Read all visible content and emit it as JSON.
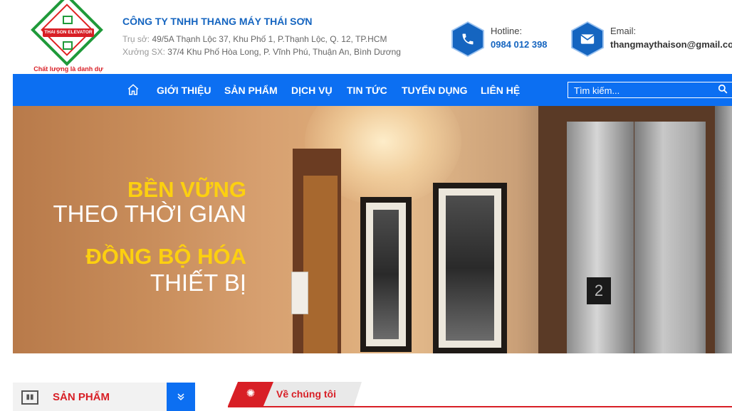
{
  "header": {
    "logo_banner_text": "THAI SON ELEVATOR",
    "logo_slogan": "Chất lượng là danh dự",
    "company_name": "CÔNG TY TNHH THANG MÁY THÁI SƠN",
    "address_label": "Trụ sở:",
    "address": "49/5A Thạnh Lộc 37, Khu Phố 1, P.Thạnh Lộc, Q. 12, TP.HCM",
    "factory_label": "Xưởng SX:",
    "factory": "37/4 Khu Phố Hòa Long, P. Vĩnh Phú, Thuận An, Bình Dương",
    "hotline_label": "Hotline:",
    "hotline": "0984 012 398",
    "email_label": "Email:",
    "email": "thangmaythaison@gmail.com"
  },
  "nav": {
    "items": [
      "GIỚI THIỆU",
      "SẢN PHẨM",
      "DỊCH VỤ",
      "TIN TỨC",
      "TUYỂN DỤNG",
      "LIÊN HỆ"
    ],
    "search_placeholder": "Tìm kiếm..."
  },
  "banner": {
    "line1": "BỀN VỮNG",
    "line2": "THEO THỜI GIAN",
    "line3": "ĐỒNG BỘ HÓA",
    "line4": "THIẾT BỊ",
    "floor": "2"
  },
  "bottom": {
    "category_label": "SẢN PHẨM",
    "about_label": "Về chúng tôi"
  },
  "colors": {
    "primary_blue": "#0c6ff2",
    "brand_red": "#d81f26",
    "brand_green": "#1f9a3a",
    "slogan_yellow": "#fcd010"
  }
}
